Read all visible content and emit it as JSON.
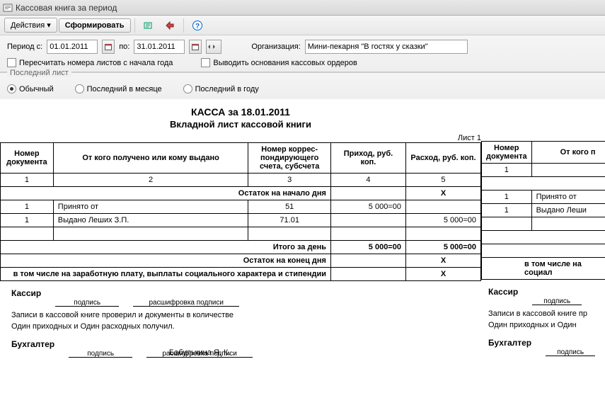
{
  "window": {
    "title": "Кассовая книга за период"
  },
  "toolbar": {
    "actions_label": "Действия",
    "form_label": "Сформировать"
  },
  "params": {
    "period_from_label": "Период с:",
    "period_to_label": "по:",
    "date_from": "01.01.2011",
    "date_to": "31.01.2011",
    "org_label": "Организация:",
    "org_value": "Мини-пекарня \"В гостях у сказки\"",
    "recalc_label": "Пересчитать номера листов с начала года",
    "basis_label": "Выводить основания кассовых ордеров"
  },
  "lastsheet": {
    "group": "Последний лист",
    "normal": "Обычный",
    "month": "Последний в месяце",
    "year": "Последний в году"
  },
  "report": {
    "title": "КАССА за 18.01.2011",
    "subtitle": "Вкладной лист кассовой книги",
    "sheet": "Лист 1",
    "headers": {
      "doc_no": "Номер документа",
      "from_to": "От кого получено или кому выдано",
      "corr": "Номер коррес- пондирующего счета, субсчета",
      "income": "Приход, руб. коп.",
      "expense": "Расход, руб. коп.",
      "from_to_short": "От кого п"
    },
    "colnums": {
      "c1": "1",
      "c2": "2",
      "c3": "3",
      "c4": "4",
      "c5": "5"
    },
    "rows": {
      "start": "Остаток на начало дня",
      "r1_doc": "1",
      "r1_txt": "Принято от",
      "r1_corr": "51",
      "r1_inc": "5 000=00",
      "r2_doc": "1",
      "r2_txt": "Выдано Леших З.П.",
      "r2_txt_short": "Выдано Леши",
      "r2_corr": "71.01",
      "r2_exp": "5 000=00",
      "total": "Итого за день",
      "total_inc": "5 000=00",
      "total_exp": "5 000=00",
      "end": "Остаток на конец дня",
      "salary": "в том числе на заработную плату, выплаты социального характера и стипендии",
      "salary_short": "в том числе на",
      "salary_short2": "социал",
      "x": "X"
    },
    "sig": {
      "cashier": "Кассир",
      "accountant": "Бухгалтер",
      "sign": "подпись",
      "decode": "расшифровка подписи",
      "acc_name": "Бабулькина Я. К.",
      "note1": "Записи в кассовой книге проверил и документы в количестве",
      "note1_short": "Записи в кассовой книге пр",
      "note2": "Один приходных и Один расходных получил.",
      "note2_short": "Один приходных и Один"
    }
  }
}
